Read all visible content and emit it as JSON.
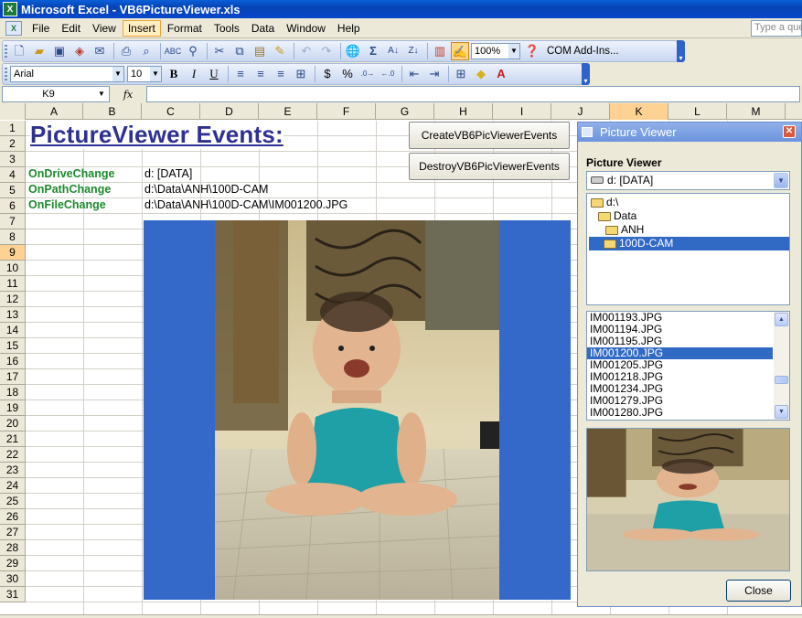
{
  "window": {
    "title": "Microsoft Excel - VB6PictureViewer.xls",
    "app_icon": "excel-icon"
  },
  "menu": {
    "items": [
      {
        "label": "File"
      },
      {
        "label": "Edit"
      },
      {
        "label": "View"
      },
      {
        "label": "Insert"
      },
      {
        "label": "Format"
      },
      {
        "label": "Tools"
      },
      {
        "label": "Data"
      },
      {
        "label": "Window"
      },
      {
        "label": "Help"
      }
    ],
    "active": "Insert",
    "ask_placeholder": "Type a question for help"
  },
  "standard_toolbar": {
    "zoom": "100%",
    "com_addins": "COM Add-Ins..."
  },
  "format_toolbar": {
    "font": "Arial",
    "size": "10",
    "bold": "B",
    "italic": "I",
    "underline": "U",
    "currency": "$",
    "percent": "%"
  },
  "formula_bar": {
    "name_box": "K9",
    "fx": "fx",
    "formula": ""
  },
  "columns": [
    "A",
    "B",
    "C",
    "D",
    "E",
    "F",
    "G",
    "H",
    "I",
    "J",
    "K",
    "L",
    "M"
  ],
  "selected_column": "K",
  "rows": [
    "1",
    "2",
    "3",
    "4",
    "5",
    "6",
    "7",
    "8",
    "9",
    "10",
    "11",
    "12",
    "13",
    "14",
    "15",
    "16",
    "17",
    "18",
    "19",
    "20",
    "21",
    "22",
    "23",
    "24",
    "25",
    "26",
    "27",
    "28",
    "29",
    "30",
    "31"
  ],
  "selected_row": "9",
  "sheet": {
    "heading": "PictureViewer Events:",
    "events": [
      {
        "label": "OnDriveChange",
        "value": "d: [DATA]"
      },
      {
        "label": "OnPathChange",
        "value": "d:\\Data\\ANH\\100D-CAM"
      },
      {
        "label": "OnFileChange",
        "value": "d:\\Data\\ANH\\100D-CAM\\IM001200.JPG"
      }
    ],
    "buttons": [
      {
        "label": "CreateVB6PicViewerEvents"
      },
      {
        "label": "DestroyVB6PicViewerEvents"
      }
    ],
    "photo_bg_color": "#3468c9"
  },
  "picture_viewer": {
    "title": "Picture Viewer",
    "label": "Picture Viewer",
    "drive": "d: [DATA]",
    "dirs": [
      {
        "label": "d:\\",
        "selected": false
      },
      {
        "label": "Data",
        "selected": false
      },
      {
        "label": "ANH",
        "selected": false
      },
      {
        "label": "100D-CAM",
        "selected": true
      }
    ],
    "files": [
      {
        "label": "IM001193.JPG",
        "selected": false
      },
      {
        "label": "IM001194.JPG",
        "selected": false
      },
      {
        "label": "IM001195.JPG",
        "selected": false
      },
      {
        "label": "IM001200.JPG",
        "selected": true
      },
      {
        "label": "IM001205.JPG",
        "selected": false
      },
      {
        "label": "IM001218.JPG",
        "selected": false
      },
      {
        "label": "IM001234.JPG",
        "selected": false
      },
      {
        "label": "IM001279.JPG",
        "selected": false
      },
      {
        "label": "IM001280.JPG",
        "selected": false
      }
    ],
    "close_label": "Close",
    "selection_color": "#316ac5"
  }
}
